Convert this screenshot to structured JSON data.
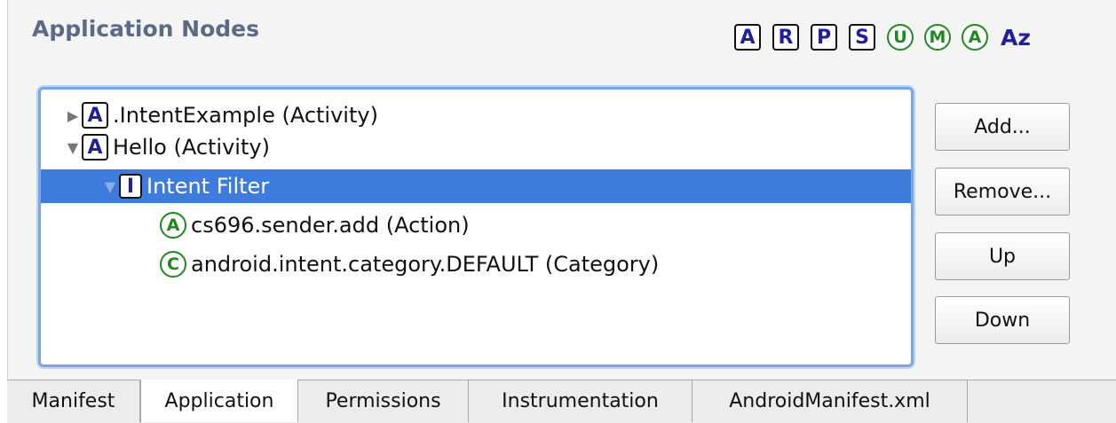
{
  "panel": {
    "title": "Application Nodes"
  },
  "filters": [
    {
      "label": "A",
      "style": "square",
      "icon": "activity-filter-icon"
    },
    {
      "label": "R",
      "style": "square",
      "icon": "receiver-filter-icon"
    },
    {
      "label": "P",
      "style": "square",
      "icon": "provider-filter-icon"
    },
    {
      "label": "S",
      "style": "square",
      "icon": "service-filter-icon"
    },
    {
      "label": "U",
      "style": "round",
      "icon": "uses-library-filter-icon"
    },
    {
      "label": "M",
      "style": "round",
      "icon": "metadata-filter-icon"
    },
    {
      "label": "A",
      "style": "round",
      "icon": "action-filter-icon"
    },
    {
      "label": "Az",
      "style": "plain",
      "icon": "sort-az-icon"
    }
  ],
  "tree": {
    "nodes": [
      {
        "label": ".IntentExample (Activity)",
        "icon_letter": "A",
        "icon_style": "square",
        "expander": "collapsed",
        "depth": 0,
        "selected": false
      },
      {
        "label": "Hello (Activity)",
        "icon_letter": "A",
        "icon_style": "square",
        "expander": "expanded",
        "depth": 0,
        "selected": false
      },
      {
        "label": "Intent Filter",
        "icon_letter": "I",
        "icon_style": "square",
        "expander": "expanded",
        "depth": 1,
        "selected": true
      },
      {
        "label": "cs696.sender.add (Action)",
        "icon_letter": "A",
        "icon_style": "round",
        "expander": "none",
        "depth": 2,
        "selected": false
      },
      {
        "label": "android.intent.category.DEFAULT (Category)",
        "icon_letter": "C",
        "icon_style": "round",
        "expander": "none",
        "depth": 2,
        "selected": false
      }
    ]
  },
  "buttons": {
    "add": "Add...",
    "remove": "Remove...",
    "up": "Up",
    "down": "Down"
  },
  "tabs": [
    {
      "label": "Manifest",
      "active": false
    },
    {
      "label": "Application",
      "active": true
    },
    {
      "label": "Permissions",
      "active": false
    },
    {
      "label": "Instrumentation",
      "active": false
    },
    {
      "label": "AndroidManifest.xml",
      "active": false
    }
  ],
  "colors": {
    "selection": "#3d7bdc",
    "filter_square": "#20209a",
    "filter_round": "#1e8a1e",
    "title": "#5a6b83"
  }
}
